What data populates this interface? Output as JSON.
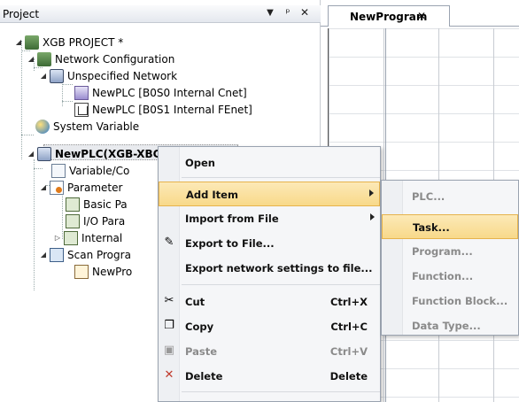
{
  "project_panel": {
    "title": "Project",
    "buttons": {
      "dropdown": "▼",
      "pin": "ᵖ",
      "close": "✕"
    },
    "tree": [
      {
        "label": "XGB PROJECT *",
        "icon": "network-icon"
      },
      {
        "label": "Network Configuration",
        "icon": "network-icon"
      },
      {
        "label": "Unspecified Network",
        "icon": "plc-icon"
      },
      {
        "label": "NewPLC [B0S0 Internal Cnet]",
        "icon": "cnet-icon"
      },
      {
        "label": "NewPLC [B0S1 Internal FEnet]",
        "icon": "fenet-icon"
      },
      {
        "label": "System Variable",
        "icon": "system-variable-icon"
      },
      {
        "label": "NewPLC(XGB-XBCU) Offl",
        "icon": "plc-icon"
      },
      {
        "label": "Variable/Co",
        "icon": "variable-icon"
      },
      {
        "label": "Parameter",
        "icon": "parameter-icon"
      },
      {
        "label": "Basic Pa",
        "icon": "basic-param-icon"
      },
      {
        "label": "I/O Para",
        "icon": "io-param-icon"
      },
      {
        "label": "Internal",
        "icon": "internal-icon"
      },
      {
        "label": "Scan Progra",
        "icon": "scan-program-icon"
      },
      {
        "label": "NewPro",
        "icon": "program-icon"
      }
    ]
  },
  "editor": {
    "tab_label": "NewProgram",
    "tab_close": "✕"
  },
  "context_menu": {
    "items": [
      {
        "label": "Open",
        "shortcut": ""
      },
      {
        "label": "Add Item",
        "shortcut": ""
      },
      {
        "label": "Import from File",
        "shortcut": ""
      },
      {
        "label": "Export to File...",
        "shortcut": ""
      },
      {
        "label": "Export network settings to file...",
        "shortcut": ""
      },
      {
        "label": "Cut",
        "shortcut": "Ctrl+X"
      },
      {
        "label": "Copy",
        "shortcut": "Ctrl+C"
      },
      {
        "label": "Paste",
        "shortcut": "Ctrl+V"
      },
      {
        "label": "Delete",
        "shortcut": "Delete"
      }
    ]
  },
  "submenu": {
    "items": [
      {
        "label": "PLC..."
      },
      {
        "label": "Task..."
      },
      {
        "label": "Program..."
      },
      {
        "label": "Function..."
      },
      {
        "label": "Function Block..."
      },
      {
        "label": "Data Type..."
      }
    ]
  },
  "colors": {
    "highlight": "#f8d98a",
    "highlight_border": "#e6b34c",
    "disabled_text": "#8a8a8a"
  }
}
